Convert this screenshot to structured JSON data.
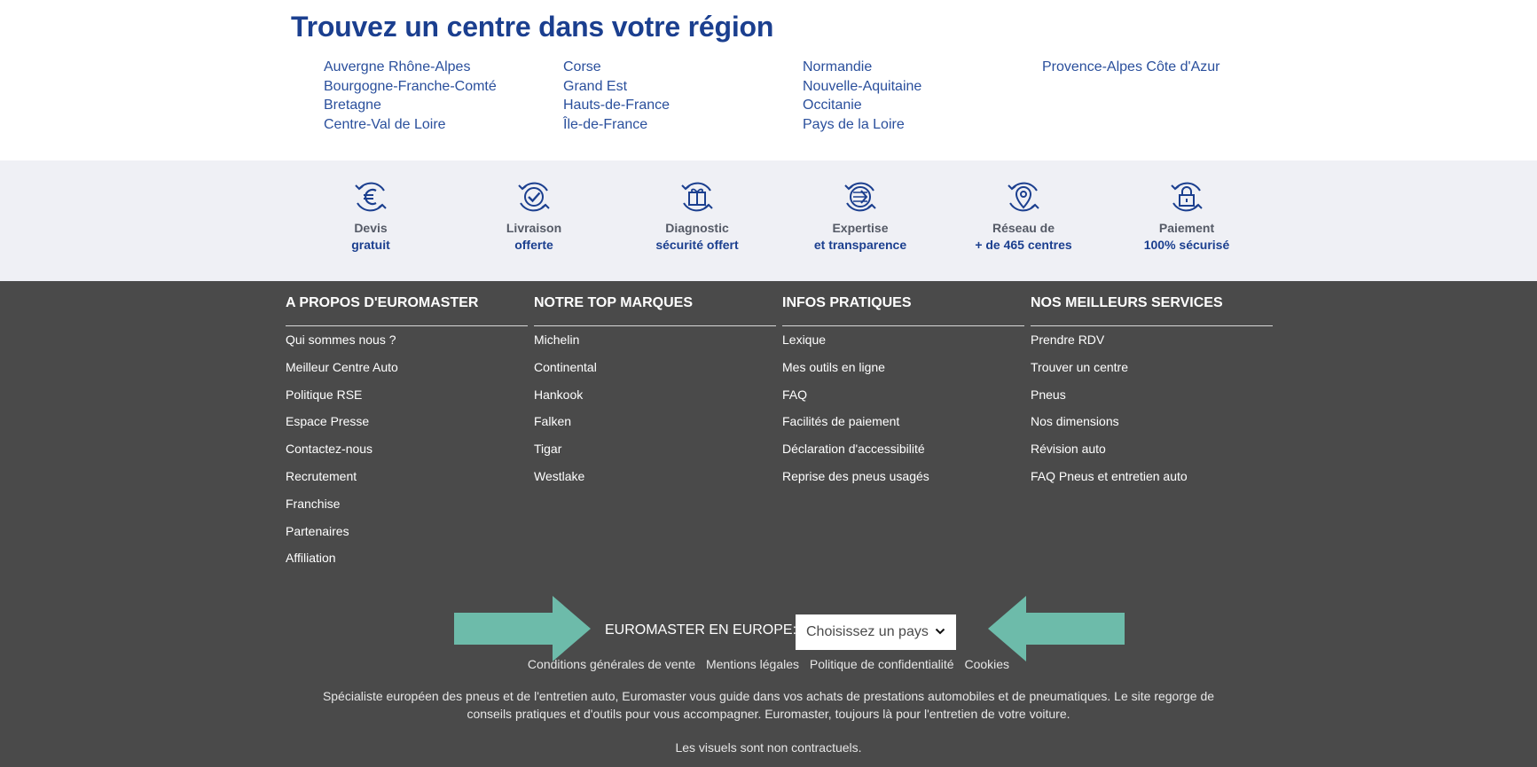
{
  "region": {
    "title": "Trouvez un centre dans votre région",
    "columns": [
      [
        "Auvergne Rhône-Alpes",
        "Bourgogne-Franche-Comté",
        "Bretagne",
        "Centre-Val de Loire"
      ],
      [
        "Corse",
        "Grand Est",
        "Hauts-de-France",
        "Île-de-France"
      ],
      [
        "Normandie",
        "Nouvelle-Aquitaine",
        "Occitanie",
        "Pays de la Loire"
      ],
      [
        "Provence-Alpes Côte d'Azur"
      ]
    ]
  },
  "features": [
    {
      "icon": "euro-icon",
      "line1": "Devis",
      "line2": "gratuit"
    },
    {
      "icon": "check-icon",
      "line1": "Livraison",
      "line2": "offerte"
    },
    {
      "icon": "gift-icon",
      "line1": "Diagnostic",
      "line2": "sécurité offert"
    },
    {
      "icon": "expertise-icon",
      "line1": "Expertise",
      "line2": "et transparence"
    },
    {
      "icon": "location-pin-icon",
      "line1": "Réseau de",
      "line2": "+ de 465 centres"
    },
    {
      "icon": "lock-icon",
      "line1": "Paiement",
      "line2": "100% sécurisé"
    }
  ],
  "footer": {
    "columns": [
      {
        "title": "A PROPOS D'EUROMASTER",
        "items": [
          "Qui sommes nous ?",
          "Meilleur Centre Auto",
          "Politique RSE",
          "Espace Presse",
          "Contactez-nous",
          "Recrutement",
          "Franchise",
          "Partenaires",
          "Affiliation"
        ]
      },
      {
        "title": "NOTRE TOP MARQUES",
        "items": [
          "Michelin",
          "Continental",
          "Hankook",
          "Falken",
          "Tigar",
          "Westlake"
        ]
      },
      {
        "title": "INFOS PRATIQUES",
        "items": [
          "Lexique",
          "Mes outils en ligne",
          "FAQ",
          "Facilités de paiement",
          "Déclaration d'accessibilité",
          "Reprise des pneus usagés"
        ]
      },
      {
        "title": "NOS MEILLEURS SERVICES",
        "items": [
          "Prendre RDV",
          "Trouver un centre",
          "Pneus",
          "Nos dimensions",
          "Révision auto",
          "FAQ Pneus et entretien auto"
        ]
      }
    ],
    "europe_label": "EUROMASTER EN EUROPE:",
    "country_select": "Choisissez un pays",
    "legal_links": [
      "Conditions générales de vente",
      "Mentions légales",
      "Politique de confidentialité",
      "Cookies"
    ],
    "description": "Spécialiste européen des pneus et de l'entretien auto, Euromaster vous guide dans vos achats de prestations automobiles et de pneumatiques. Le site regorge de conseils pratiques et d'outils pour vous accompagner. Euromaster, toujours là pour l'entretien de votre voiture.",
    "disclaimer": "Les visuels sont non contractuels."
  },
  "colors": {
    "brand_blue": "#1b3f8f",
    "footer_bg": "#4a4a4a",
    "arrow_teal": "#6dbbaa",
    "band_bg": "#eff0f5"
  }
}
